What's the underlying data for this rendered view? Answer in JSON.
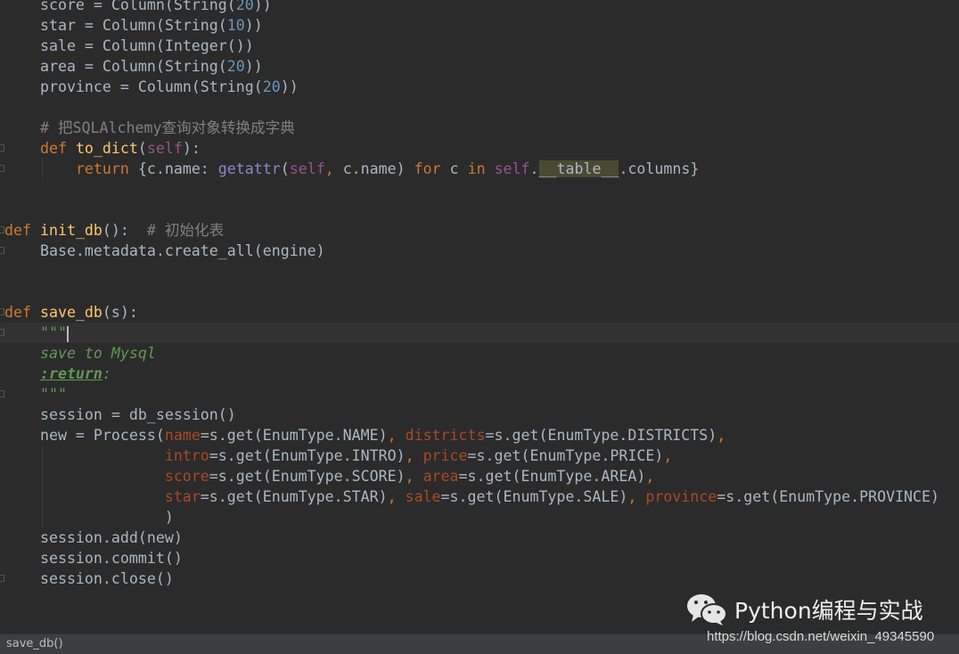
{
  "code": {
    "lines": [
      {
        "indent": "    ",
        "tokens": [
          [
            "score = Column(String(",
            ""
          ],
          [
            "20",
            "num"
          ],
          [
            "))",
            ""
          ]
        ]
      },
      {
        "indent": "    ",
        "tokens": [
          [
            "star = Column(String(",
            ""
          ],
          [
            "10",
            "num"
          ],
          [
            "))",
            ""
          ]
        ]
      },
      {
        "indent": "    ",
        "tokens": [
          [
            "sale = Column(Integer())",
            ""
          ]
        ]
      },
      {
        "indent": "    ",
        "tokens": [
          [
            "area = Column(String(",
            ""
          ],
          [
            "20",
            "num"
          ],
          [
            "))",
            ""
          ]
        ]
      },
      {
        "indent": "    ",
        "tokens": [
          [
            "province = Column(String(",
            ""
          ],
          [
            "20",
            "num"
          ],
          [
            "))",
            ""
          ]
        ]
      },
      {
        "indent": "",
        "tokens": []
      },
      {
        "indent": "    ",
        "tokens": [
          [
            "# 把SQLAlchemy查询对象转换成字典",
            "cmt"
          ]
        ]
      },
      {
        "indent": "    ",
        "fold": true,
        "tokens": [
          [
            "def ",
            "kw"
          ],
          [
            "to_dict",
            "fn"
          ],
          [
            "(",
            ""
          ],
          [
            "self",
            "self"
          ],
          [
            "):",
            ""
          ]
        ]
      },
      {
        "indent": "        ",
        "fold": true,
        "guide": true,
        "tokens": [
          [
            "return ",
            "kw"
          ],
          [
            "{c.name: ",
            ""
          ],
          [
            "getattr",
            "bi"
          ],
          [
            "(",
            ""
          ],
          [
            "self",
            "self"
          ],
          [
            ", ",
            "kw"
          ],
          [
            "c.name) ",
            ""
          ],
          [
            "for ",
            "kw"
          ],
          [
            "c ",
            ""
          ],
          [
            "in ",
            "kw"
          ],
          [
            "self",
            "self"
          ],
          [
            ".",
            ""
          ],
          [
            "__table__",
            "hl"
          ],
          [
            ".columns}",
            ""
          ]
        ]
      },
      {
        "indent": "",
        "tokens": []
      },
      {
        "indent": "",
        "tokens": []
      },
      {
        "indent": "",
        "fold": true,
        "tokens": [
          [
            "def ",
            "kw"
          ],
          [
            "init_db",
            "fn"
          ],
          [
            "():  ",
            ""
          ],
          [
            "# 初始化表",
            "cmt"
          ]
        ]
      },
      {
        "indent": "    ",
        "fold": true,
        "tokens": [
          [
            "Base.metadata.create_all(engine)",
            ""
          ]
        ]
      },
      {
        "indent": "",
        "tokens": []
      },
      {
        "indent": "",
        "tokens": []
      },
      {
        "indent": "",
        "fold": true,
        "tokens": [
          [
            "def ",
            "kw"
          ],
          [
            "save_db",
            "fn"
          ],
          [
            "(s):",
            ""
          ]
        ]
      },
      {
        "indent": "    ",
        "fold": true,
        "current": true,
        "caret": true,
        "tokens": [
          [
            "\"\"\"",
            "doc"
          ]
        ]
      },
      {
        "indent": "    ",
        "tokens": [
          [
            "save to Mysql",
            "doc"
          ]
        ]
      },
      {
        "indent": "    ",
        "tokens": [
          [
            ":return",
            "doctag"
          ],
          [
            ":",
            "doc"
          ]
        ]
      },
      {
        "indent": "    ",
        "fold": true,
        "tokens": [
          [
            "\"\"\"",
            "doc"
          ]
        ]
      },
      {
        "indent": "    ",
        "tokens": [
          [
            "session = db_session()",
            ""
          ]
        ]
      },
      {
        "indent": "    ",
        "tokens": [
          [
            "new = Process(",
            ""
          ],
          [
            "name",
            "arg"
          ],
          [
            "=s.get(EnumType.NAME)",
            ""
          ],
          [
            ", ",
            "kw"
          ],
          [
            "districts",
            "arg"
          ],
          [
            "=s.get(EnumType.DISTRICTS)",
            ""
          ],
          [
            ",",
            "kw"
          ]
        ]
      },
      {
        "indent": "                  ",
        "guide": true,
        "tokens": [
          [
            "intro",
            "arg"
          ],
          [
            "=s.get(EnumType.INTRO)",
            ""
          ],
          [
            ", ",
            "kw"
          ],
          [
            "price",
            "arg"
          ],
          [
            "=s.get(EnumType.PRICE)",
            ""
          ],
          [
            ",",
            "kw"
          ]
        ]
      },
      {
        "indent": "                  ",
        "guide": true,
        "tokens": [
          [
            "score",
            "arg"
          ],
          [
            "=s.get(EnumType.SCORE)",
            ""
          ],
          [
            ", ",
            "kw"
          ],
          [
            "area",
            "arg"
          ],
          [
            "=s.get(EnumType.AREA)",
            ""
          ],
          [
            ",",
            "kw"
          ]
        ]
      },
      {
        "indent": "                  ",
        "guide": true,
        "tokens": [
          [
            "star",
            "arg"
          ],
          [
            "=s.get(EnumType.STAR)",
            ""
          ],
          [
            ", ",
            "kw"
          ],
          [
            "sale",
            "arg"
          ],
          [
            "=s.get(EnumType.SALE)",
            ""
          ],
          [
            ", ",
            "kw"
          ],
          [
            "province",
            "arg"
          ],
          [
            "=s.get(EnumType.PROVINCE)",
            ""
          ]
        ]
      },
      {
        "indent": "                  ",
        "guide": true,
        "tokens": [
          [
            ")",
            ""
          ]
        ]
      },
      {
        "indent": "    ",
        "tokens": [
          [
            "session.add(new)",
            ""
          ]
        ]
      },
      {
        "indent": "    ",
        "tokens": [
          [
            "session.commit()",
            ""
          ]
        ]
      },
      {
        "indent": "    ",
        "fold": true,
        "tokens": [
          [
            "session.close()",
            ""
          ]
        ]
      }
    ]
  },
  "statusbar": {
    "breadcrumb": "save_db()"
  },
  "watermark": {
    "icon": "wechat-icon",
    "title": "Python编程与实战",
    "url": "https://blog.csdn.net/weixin_49345590"
  }
}
